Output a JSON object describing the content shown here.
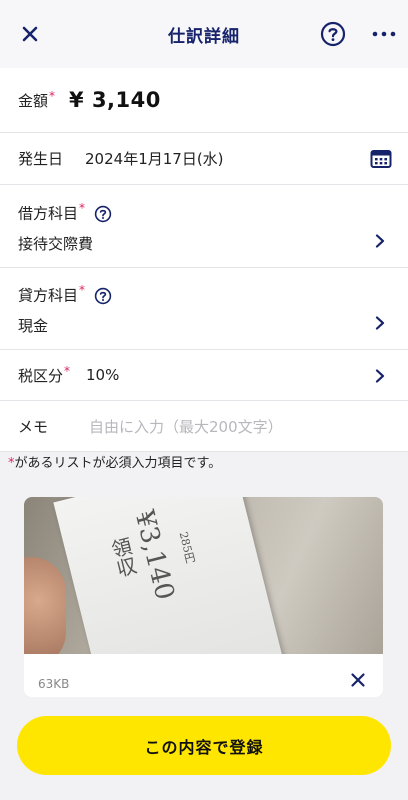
{
  "header": {
    "title": "仕訳詳細"
  },
  "fields": {
    "amount": {
      "label": "金額",
      "required_mark": "*",
      "value": "¥ 3,140"
    },
    "date": {
      "label": "発生日",
      "value": "2024年1月17日(水)"
    },
    "debit": {
      "label": "借方科目",
      "required_mark": "*",
      "value": "接待交際費"
    },
    "credit": {
      "label": "貸方科目",
      "required_mark": "*",
      "value": "現金"
    },
    "tax": {
      "label": "税区分",
      "required_mark": "*",
      "value": "10%"
    },
    "memo": {
      "label": "メモ",
      "placeholder": "自由に入力（最大200文字）"
    }
  },
  "note": {
    "mark": "*",
    "text": "があるリストが必須入力項目です。"
  },
  "attachment": {
    "file_size": "63KB",
    "receipt_text": {
      "amount": "¥3,140",
      "title": "領収",
      "sub": "285円"
    }
  },
  "submit": {
    "label": "この内容で登録"
  },
  "colors": {
    "accent": "#16236b",
    "required": "#e0245e",
    "submit_bg": "#ffe600"
  },
  "icons": {
    "close": "close-icon",
    "help": "help-icon",
    "more": "more-icon",
    "calendar": "calendar-icon",
    "chevron": "chevron-right-icon",
    "remove": "remove-icon"
  }
}
